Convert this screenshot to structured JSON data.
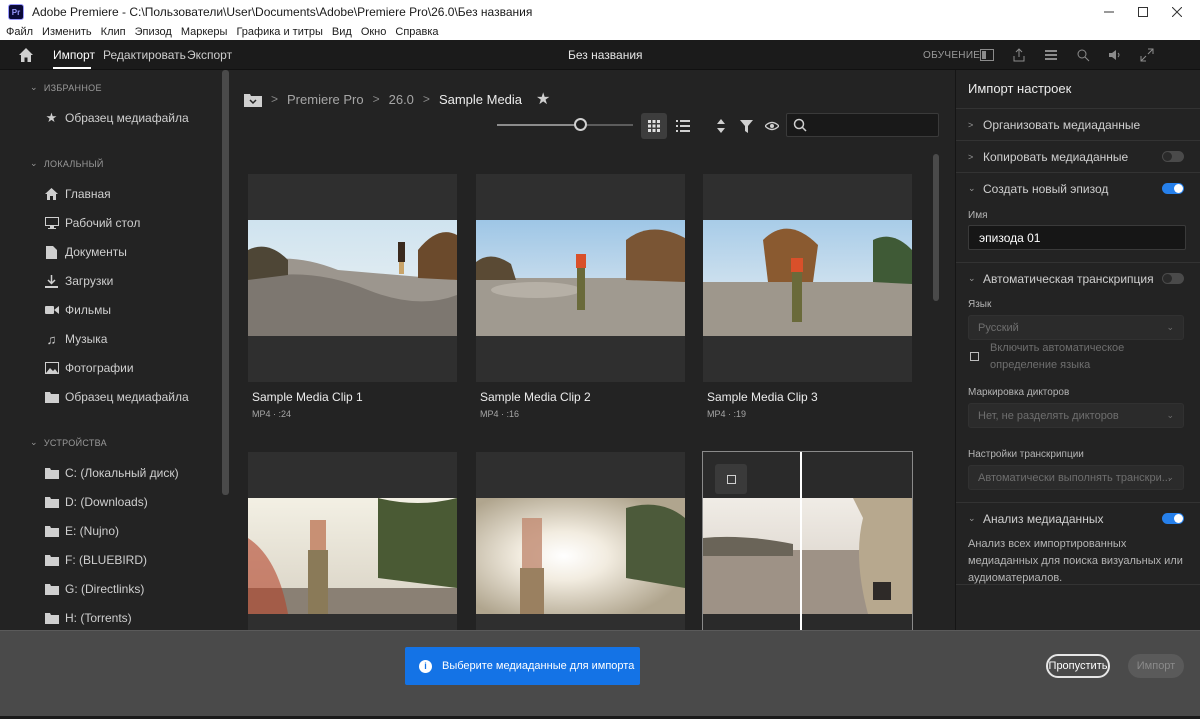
{
  "window": {
    "title": "Adobe Premiere - C:\\Пользователи\\User\\Documents\\Adobe\\Premiere Pro\\26.0\\Без названия",
    "logo": "Pr"
  },
  "menu": [
    "Файл",
    "Изменить",
    "Клип",
    "Эпизод",
    "Маркеры",
    "Графика и титры",
    "Вид",
    "Окно",
    "Справка"
  ],
  "header": {
    "tabs": [
      "Импорт",
      "Редактировать",
      "Экспорт"
    ],
    "active_tab": "Импорт",
    "project_title": "Без названия",
    "learn_label": "ОБУЧЕНИЕ"
  },
  "sidebar": {
    "favorites_label": "ИЗБРАННОЕ",
    "favorites": [
      {
        "label": "Образец медиафайла",
        "icon": "star-icon"
      }
    ],
    "local_label": "ЛОКАЛЬНЫЙ",
    "local": [
      {
        "label": "Главная",
        "icon": "home-icon"
      },
      {
        "label": "Рабочий стол",
        "icon": "monitor-icon"
      },
      {
        "label": "Документы",
        "icon": "document-icon"
      },
      {
        "label": "Загрузки",
        "icon": "download-icon"
      },
      {
        "label": "Фильмы",
        "icon": "video-camera-icon"
      },
      {
        "label": "Музыка",
        "icon": "music-note-icon"
      },
      {
        "label": "Фотографии",
        "icon": "image-icon"
      },
      {
        "label": "Образец медиафайла",
        "icon": "folder-icon"
      }
    ],
    "devices_label": "УСТРОЙСТВА",
    "devices": [
      {
        "label": "C: (Локальный диск)",
        "icon": "folder-icon"
      },
      {
        "label": "D: (Downloads)",
        "icon": "folder-icon"
      },
      {
        "label": "E: (Nujno)",
        "icon": "folder-icon"
      },
      {
        "label": "F: (BLUEBIRD)",
        "icon": "folder-icon"
      },
      {
        "label": "G: (Directlinks)",
        "icon": "folder-icon"
      },
      {
        "label": "H: (Torrents)",
        "icon": "folder-icon"
      }
    ]
  },
  "breadcrumb": [
    "Premiere Pro",
    "26.0",
    "Sample Media"
  ],
  "clips": [
    {
      "name": "Sample Media Clip 1",
      "meta": "MP4 · :24"
    },
    {
      "name": "Sample Media Clip 2",
      "meta": "MP4 · :16"
    },
    {
      "name": "Sample Media Clip 3",
      "meta": "MP4 · :19"
    },
    {
      "name": "",
      "meta": ""
    },
    {
      "name": "",
      "meta": ""
    },
    {
      "name": "",
      "meta": ""
    }
  ],
  "import_settings": {
    "title": "Импорт настроек",
    "organize": "Организовать медиаданные",
    "copy": "Копировать медиаданные",
    "copy_on": false,
    "create_sequence": "Создать новый эпизод",
    "create_sequence_on": true,
    "name_label": "Имя",
    "name_value": "эпизода 01",
    "auto_transcribe": "Автоматическая транскрипция",
    "auto_transcribe_on": false,
    "language_label": "Язык",
    "language_value": "Русский",
    "auto_detect": "Включить автоматическое определение языка",
    "speaker_label": "Маркировка дикторов",
    "speaker_value": "Нет, не разделять дикторов",
    "transcript_settings_label": "Настройки транскрипции",
    "transcript_settings_value": "Автоматически выполнять транскри...",
    "media_analysis": "Анализ медиаданных",
    "media_analysis_on": true,
    "media_analysis_desc": "Анализ всех импортированных медиаданных для поиска визуальных или аудиоматериалов."
  },
  "footer": {
    "toast": "Выберите медиаданные для импорта",
    "skip": "Пропустить",
    "import": "Импорт"
  },
  "colors": {
    "accent": "#1473e6",
    "toggle_on": "#2680eb"
  }
}
